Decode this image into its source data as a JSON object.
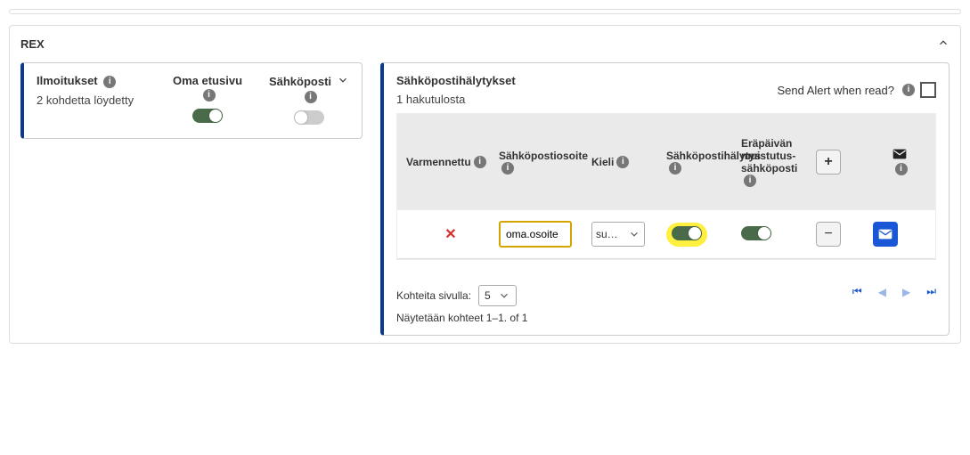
{
  "section": {
    "title": "REX"
  },
  "notifications": {
    "title": "Ilmoitukset",
    "found": "2 kohdetta löydetty",
    "homepage_label": "Oma etusivu",
    "email_label": "Sähköposti",
    "homepage_on": "true",
    "email_on": "false"
  },
  "email_alerts": {
    "title": "Sähköpostihälytykset",
    "results": "1 hakutulosta",
    "send_alert_label": "Send Alert when read?",
    "columns": {
      "verified": "Varmennettu",
      "email": "Sähköpostiosoite",
      "language": "Kieli",
      "alert": "Sähköpostihälytys",
      "due": "Eräpäivän muistutus-sähköposti"
    },
    "rows": [
      {
        "verified": "false",
        "email": "oma.osoite",
        "lang_display": "su…",
        "alert_on": "true",
        "due_on": "true"
      }
    ],
    "items_per_page_label": "Kohteita sivulla:",
    "items_per_page_value": "5",
    "showing": "Näytetään kohteet 1–1. of 1"
  }
}
